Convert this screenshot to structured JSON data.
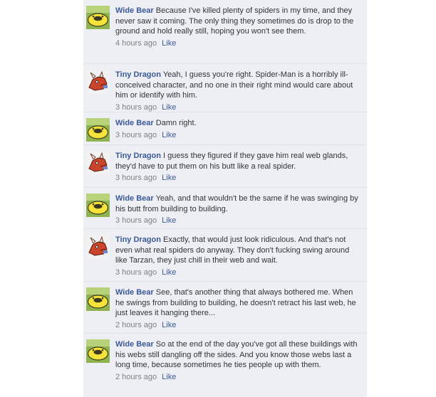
{
  "comments": [
    {
      "author": "Wide Bear",
      "avatar": "bear-avatar",
      "text": "Because I've killed plenty of spiders in my time, and they never saw it coming. The only thing they sometimes do is drop to the ground and hold really still, hoping you won't see them.",
      "time": "4 hours ago",
      "like": "Like"
    },
    {
      "author": "Tiny Dragon",
      "avatar": "dragon-avatar",
      "text": "Yeah, I guess you're right. Spider-Man is a horribly ill-conceived character, and no one in their right mind would care about him or identify with him.",
      "time": "3 hours ago",
      "like": "Like"
    },
    {
      "author": "Wide Bear",
      "avatar": "bear-avatar",
      "text": "Damn right.",
      "time": "3 hours ago",
      "like": "Like"
    },
    {
      "author": "Tiny Dragon",
      "avatar": "dragon-avatar",
      "text": "I guess they figured if they gave him real web glands, they'd have to put them on his butt like a real spider.",
      "time": "3 hours ago",
      "like": "Like"
    },
    {
      "author": "Wide Bear",
      "avatar": "bear-avatar",
      "text": "Yeah, and that wouldn't be the same if he was swinging by his butt from building to building.",
      "time": "3 hours ago",
      "like": "Like"
    },
    {
      "author": "Tiny Dragon",
      "avatar": "dragon-avatar",
      "text": "Exactly, that would just look ridiculous. And that's not even what real spiders do anyway. They don't fucking swing around like Tarzan, they just chill in their web and wait.",
      "time": "3 hours ago",
      "like": "Like"
    },
    {
      "author": "Wide Bear",
      "avatar": "bear-avatar",
      "text": "See, that's another thing that always bothered me. When he swings from building to building, he doesn't retract his last web, he just leaves it hanging there...",
      "time": "2 hours ago",
      "like": "Like"
    },
    {
      "author": "Wide Bear",
      "avatar": "bear-avatar",
      "text": "So at the end of the day you've got all these buildings with his webs still dangling off the sides. And you know those webs last a long time, because sometimes he ties people up with them.",
      "time": "2 hours ago",
      "like": "Like"
    }
  ],
  "colors": {
    "background": "#edeff4",
    "author": "#3b5998",
    "link": "#3b5998",
    "meta": "#808080",
    "text": "#333333",
    "divider": "#e1e3ea"
  }
}
